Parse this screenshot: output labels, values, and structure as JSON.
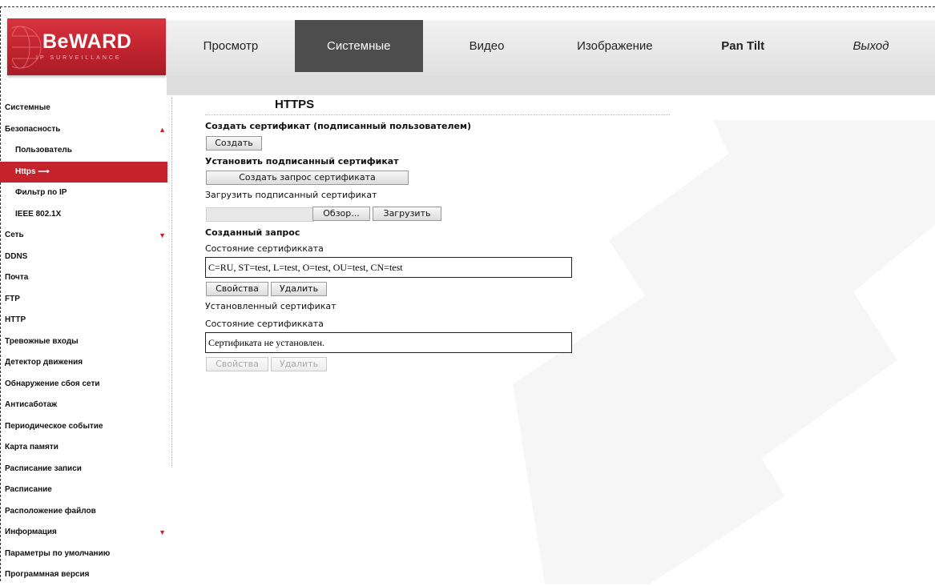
{
  "header": {
    "logo_text": "BeWARD",
    "logo_subtext": "IP SURVEILLANCE",
    "tabs": [
      {
        "label": "Просмотр"
      },
      {
        "label": "Системные"
      },
      {
        "label": "Видео"
      },
      {
        "label": "Изображение"
      },
      {
        "label": "Pan Tilt"
      },
      {
        "label": "Выход"
      }
    ],
    "active_tab": "Системные"
  },
  "sidebar": {
    "items": [
      {
        "label": "Системные"
      },
      {
        "label": "Безопасность",
        "arrow": "▲"
      },
      {
        "label": "Пользователь"
      },
      {
        "label": "Https",
        "suffix": "⟶"
      },
      {
        "label": "Фильтр по IP"
      },
      {
        "label": "IEEE 802.1X"
      },
      {
        "label": "Сеть",
        "arrow": "▼"
      },
      {
        "label": "DDNS"
      },
      {
        "label": "Почта"
      },
      {
        "label": "FTP"
      },
      {
        "label": "HTTP"
      },
      {
        "label": "Тревожные входы"
      },
      {
        "label": "Детектор движения"
      },
      {
        "label": "Обнаружение сбоя сети"
      },
      {
        "label": "Антисаботаж"
      },
      {
        "label": "Периодическое событие"
      },
      {
        "label": "Карта памяти"
      },
      {
        "label": "Расписание записи"
      },
      {
        "label": "Расписание"
      },
      {
        "label": "Расположение файлов"
      },
      {
        "label": "Информация",
        "arrow": "▼"
      },
      {
        "label": "Параметры по умолчанию"
      },
      {
        "label": "Программная версия"
      }
    ]
  },
  "main": {
    "title": "HTTPS",
    "create_cert_label": "Создать сертификат (подписанный пользователем)",
    "create_button": "Создать",
    "install_cert_label": "Установить подписанный сертификат",
    "create_request_button": "Создать запрос сертификата",
    "upload_signed_label": "Загрузить подписанный сертификат",
    "browse_button": "Обзор...",
    "upload_button": "Загрузить",
    "created_request_label": "Созданный запрос",
    "cert_status_label_1": "Состояние сертификката",
    "cert_status_value_1": "C=RU, ST=test, L=test, O=test, OU=test, CN=test",
    "properties_button_1": "Свойства",
    "delete_button_1": "Удалить",
    "installed_cert_label": "Установленный сертификат",
    "cert_status_label_2": "Состояние сертификката",
    "cert_status_value_2": "Сертификата не установлен.",
    "properties_button_2": "Свойства",
    "delete_button_2": "Удалить"
  },
  "colors": {
    "brand_red": "#c4232d",
    "active_tab": "#4d4d4d"
  }
}
